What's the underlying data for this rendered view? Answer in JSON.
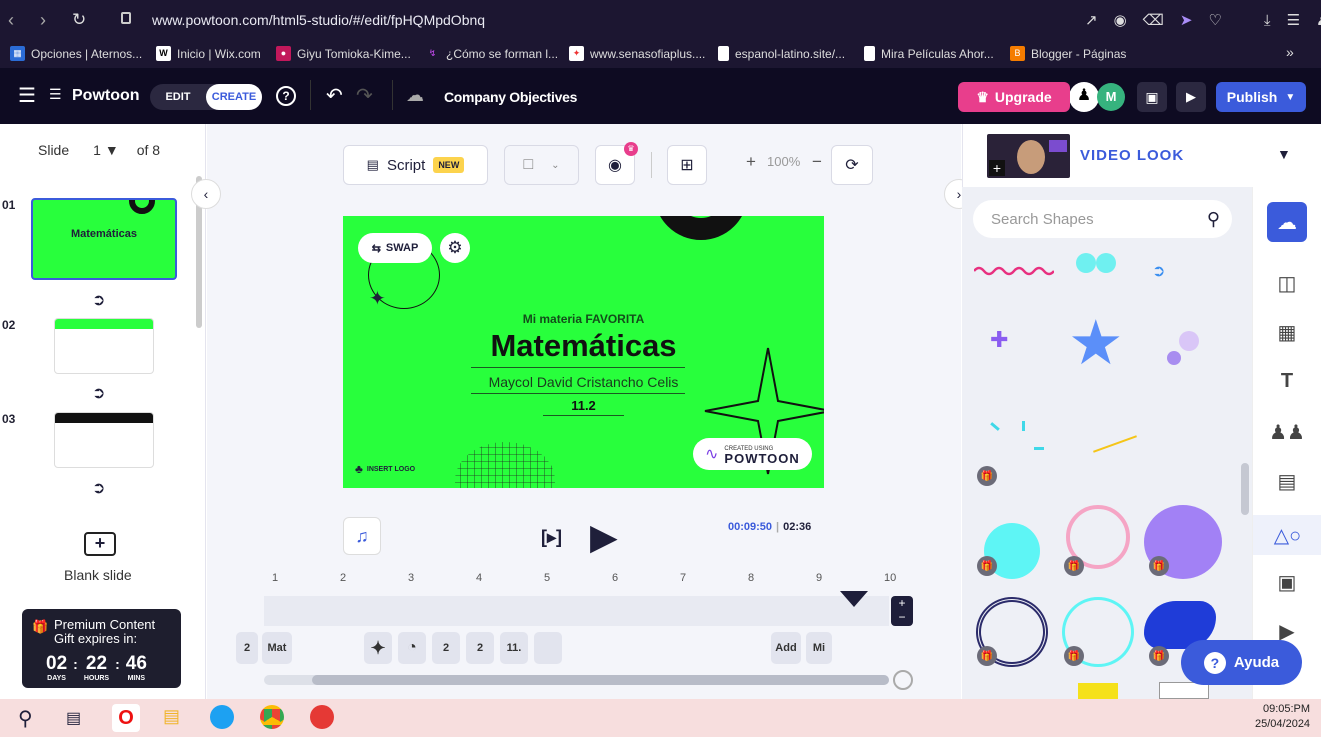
{
  "browser": {
    "url": "www.powtoon.com/html5-studio/#/edit/fpHQMpdObnq",
    "bookmarks": [
      {
        "label": "Opciones | Aternos...",
        "icon": "aternos-icon",
        "color": "#2b6cd6"
      },
      {
        "label": "Inicio | Wix.com",
        "icon": "wix-icon",
        "color": "#000000"
      },
      {
        "label": "Giyu Tomioka-Kime...",
        "icon": "pinterest-icon",
        "color": "#c2185b"
      },
      {
        "label": "¿Cómo se forman l...",
        "icon": "bookmark-swirl-icon",
        "color": "#8e3fbf"
      },
      {
        "label": "www.senasofiaplus....",
        "icon": "sena-icon",
        "color": "#ffffff"
      },
      {
        "label": "espanol-latino.site/...",
        "icon": "page-icon",
        "color": "#ffffff"
      },
      {
        "label": "Mira Películas Ahor...",
        "icon": "page-icon",
        "color": "#ffffff"
      },
      {
        "label": "Blogger - Páginas",
        "icon": "blogger-icon",
        "color": "#f57c00"
      }
    ],
    "more": "»"
  },
  "app": {
    "logo": "Powtoon",
    "mode_edit": "EDIT",
    "mode_create": "CREATE",
    "project_title": "Company Objectives",
    "upgrade_label": "Upgrade",
    "avatar_letter": "M",
    "publish_label": "Publish",
    "accent": "#3b5bdb",
    "upgrade_color": "#e83e8c"
  },
  "slides": {
    "label": "Slide",
    "current": "1",
    "of_label": "of 8",
    "items": [
      {
        "num": "01"
      },
      {
        "num": "02"
      },
      {
        "num": "03"
      }
    ],
    "blank_label": "Blank slide"
  },
  "premium": {
    "line1": "Premium Content",
    "line2": "Gift expires in:",
    "days": "02",
    "hours": "22",
    "mins": "46",
    "days_label": "DAYS",
    "hours_label": "HOURS",
    "mins_label": "MINS"
  },
  "toolbar": {
    "script_label": "Script",
    "new_badge": "NEW",
    "zoom": "100%"
  },
  "canvas": {
    "bg_color": "#28ff3c",
    "swap_label": "SWAP",
    "subtitle": "Mi materia FAVORITA",
    "title": "Matemáticas",
    "author": "Maycol David Cristancho Celis",
    "grade": "11.2",
    "insert_logo": "INSERT LOGO",
    "created_using": "CREATED USING",
    "powtoon_badge": "POWTOON"
  },
  "player": {
    "current_time": "00:09:50",
    "total_time": "02:36"
  },
  "timeline": {
    "ticks": [
      "1",
      "2",
      "3",
      "4",
      "5",
      "6",
      "7",
      "8",
      "9",
      "10"
    ],
    "items": [
      "2",
      "Mat",
      "2",
      "2",
      "11.",
      "Add",
      "Mi"
    ]
  },
  "right": {
    "video_look": "VIDEO LOOK",
    "search_placeholder": "Search Shapes",
    "help_label": "Ayuda"
  },
  "taskbar": {
    "time": "09:05:PM",
    "date": "25/04/2024"
  }
}
